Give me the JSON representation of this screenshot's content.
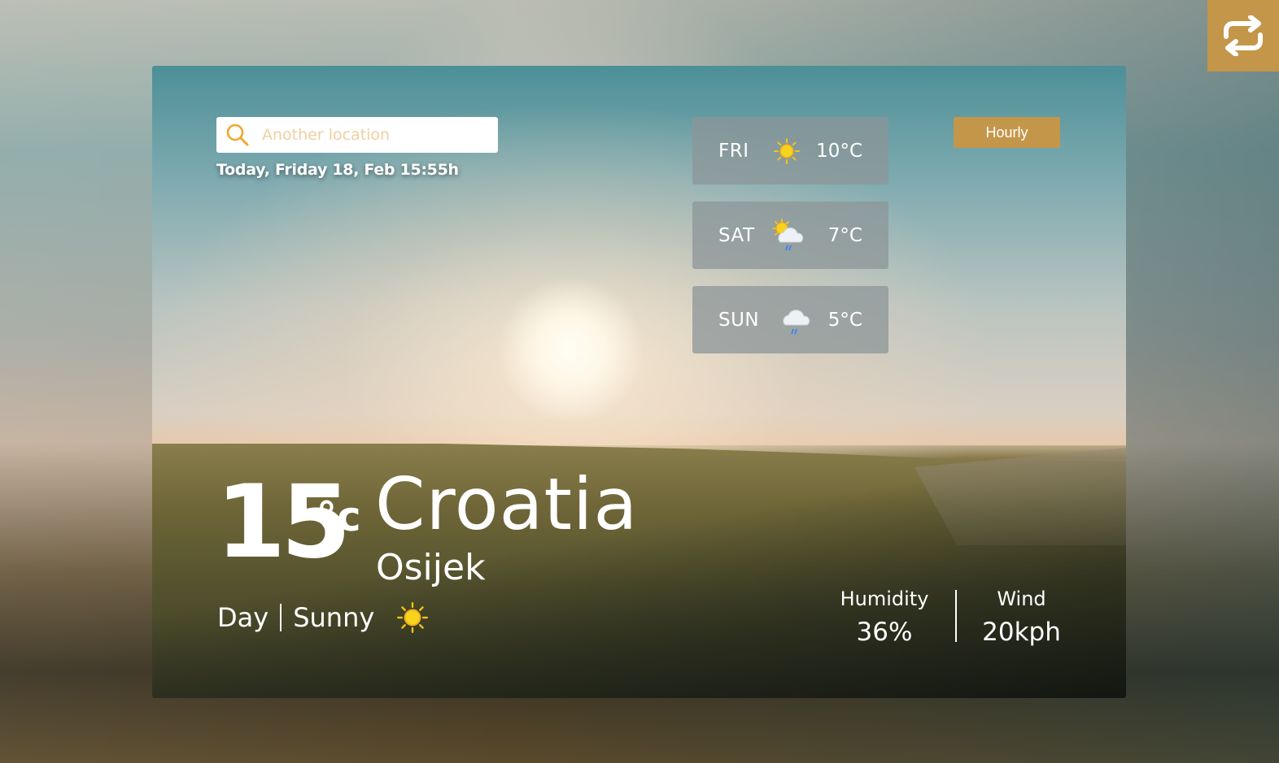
{
  "search": {
    "placeholder": "Another location",
    "icon": "search-icon"
  },
  "date_line": "Today, Friday 18, Feb 15:55h",
  "forecast": [
    {
      "day": "FRI",
      "temp": "10°C",
      "icon": "sun-icon"
    },
    {
      "day": "SAT",
      "temp": "7°C",
      "icon": "sun-cloud-rain-icon"
    },
    {
      "day": "SUN",
      "temp": "5°C",
      "icon": "cloud-rain-icon"
    }
  ],
  "hourly_label": "Hourly",
  "current": {
    "temp": "15",
    "unit": "°c",
    "country": "Croatia",
    "city": "Osijek",
    "period": "Day",
    "condition": "Sunny",
    "icon": "sun-icon"
  },
  "stats": {
    "humidity_label": "Humidity",
    "humidity_value": "36%",
    "wind_label": "Wind",
    "wind_value": "20kph"
  },
  "colors": {
    "accent": "#c4964a",
    "sun": "#f5c518",
    "rain": "#3b82f6"
  }
}
